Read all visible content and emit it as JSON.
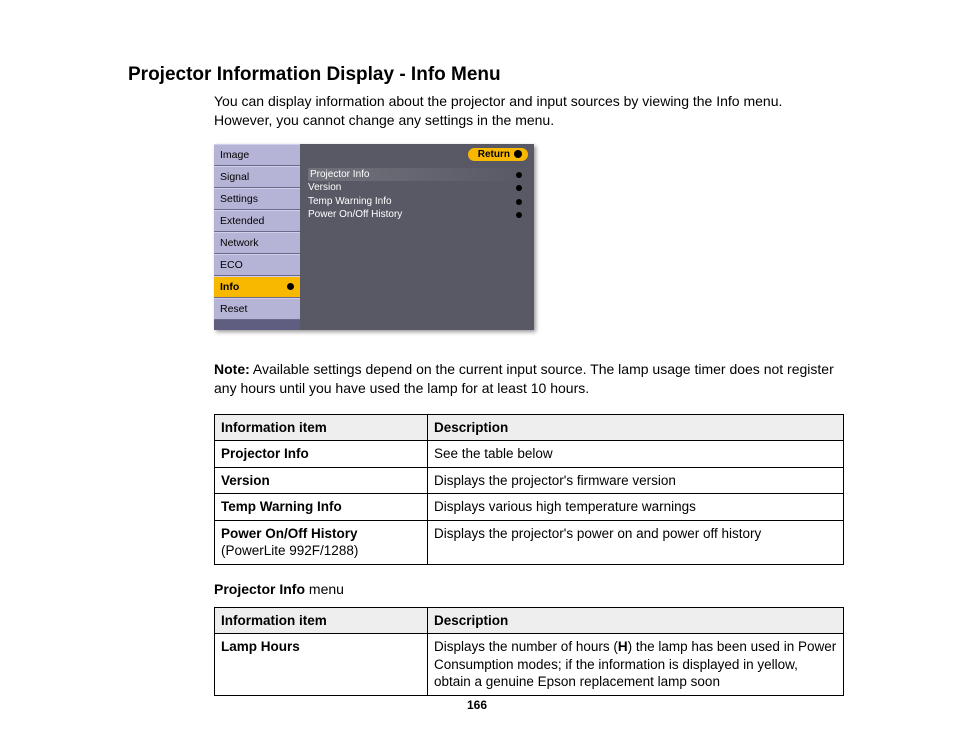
{
  "title": "Projector Information Display - Info Menu",
  "intro": "You can display information about the projector and input sources by viewing the Info menu. However, you cannot change any settings in the menu.",
  "osd": {
    "menu": [
      "Image",
      "Signal",
      "Settings",
      "Extended",
      "Network",
      "ECO",
      "Info",
      "Reset"
    ],
    "active_index": 6,
    "return_label": "Return",
    "items": [
      "Projector Info",
      "Version",
      "Temp Warning Info",
      "Power On/Off History"
    ]
  },
  "note_label": "Note:",
  "note": " Available settings depend on the current input source. The lamp usage timer does not register any hours until you have used the lamp for at least 10 hours.",
  "table1": {
    "headers": [
      "Information item",
      "Description"
    ],
    "rows": [
      {
        "item": "Projector Info",
        "sub": "",
        "desc": "See the table below"
      },
      {
        "item": "Version",
        "sub": "",
        "desc": "Displays the projector's firmware version"
      },
      {
        "item": "Temp Warning Info",
        "sub": "",
        "desc": "Displays various high temperature warnings"
      },
      {
        "item": "Power On/Off History",
        "sub": "(PowerLite 992F/1288)",
        "desc": "Displays the projector's power on and power off history"
      }
    ]
  },
  "subhead_bold": "Projector Info",
  "subhead_rest": " menu",
  "table2": {
    "headers": [
      "Information item",
      "Description"
    ],
    "rows": [
      {
        "item": "Lamp Hours",
        "desc_pre": "Displays the number of hours (",
        "desc_bold": "H",
        "desc_post": ") the lamp has been used in Power Consumption modes; if the information is displayed in yellow, obtain a genuine Epson replacement lamp soon"
      }
    ]
  },
  "page_number": "166"
}
